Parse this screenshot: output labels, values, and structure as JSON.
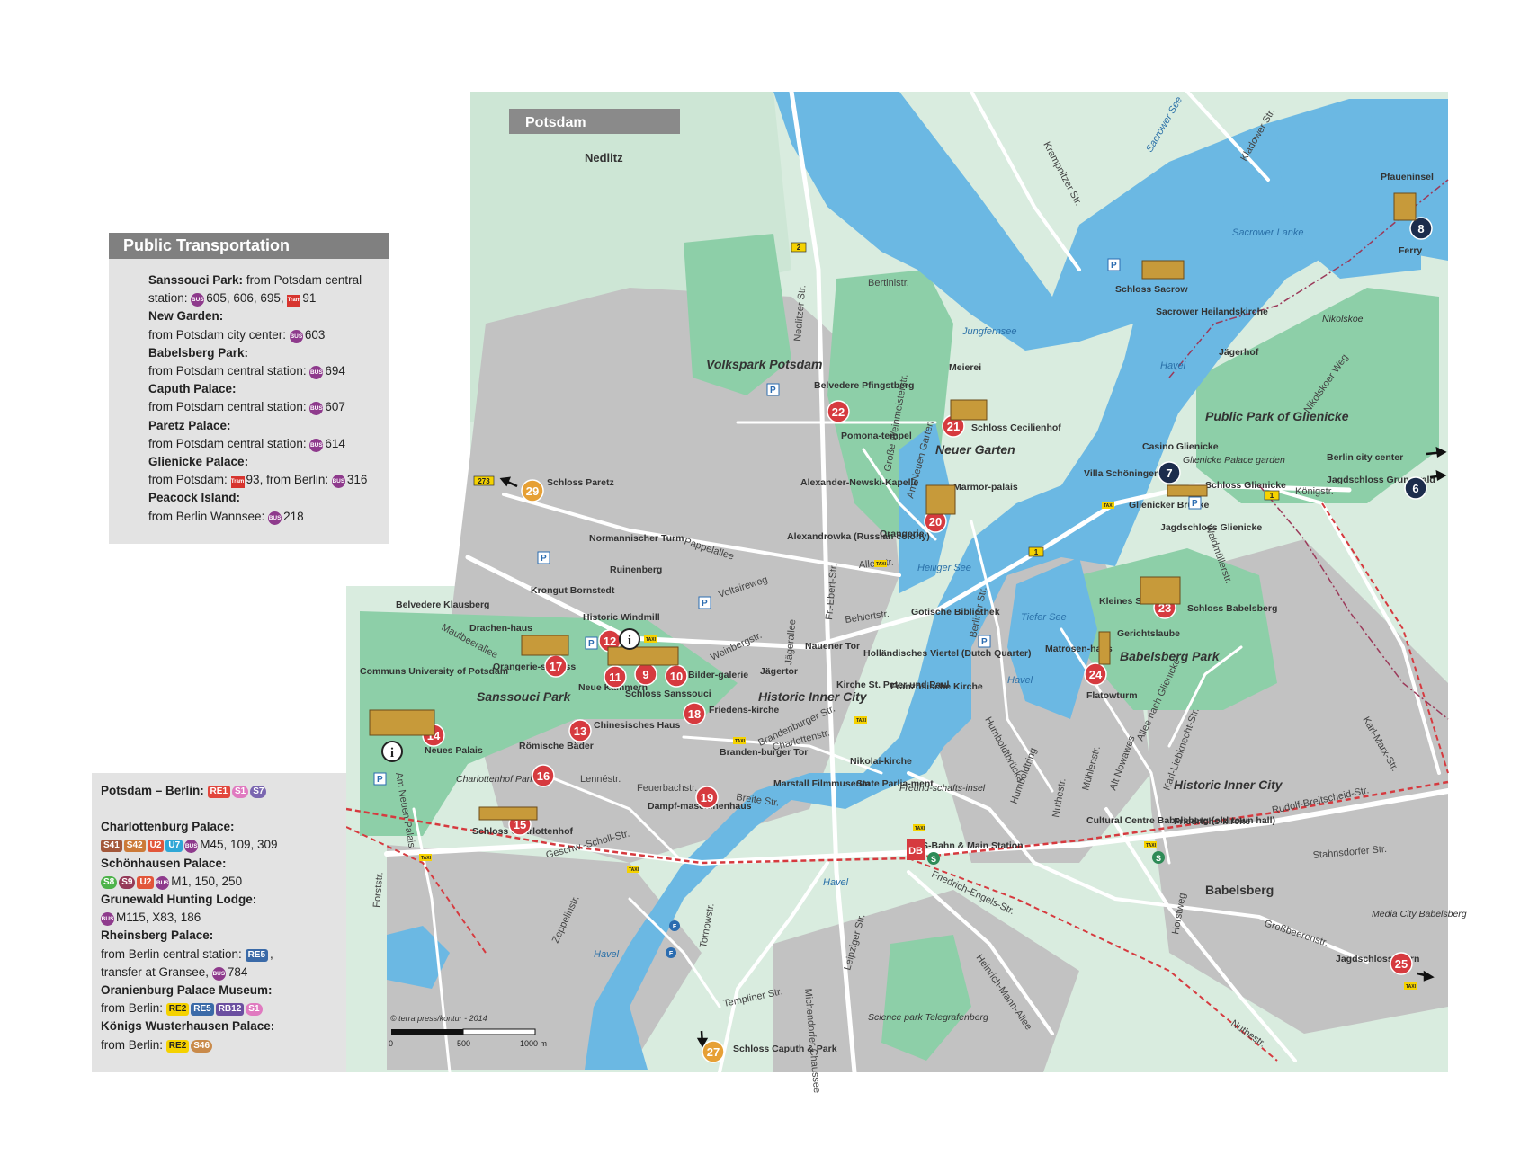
{
  "map": {
    "title": "Potsdam",
    "districts": [
      "Nedlitz",
      "Volkspark Potsdam",
      "Sanssouci Park",
      "Neuer Garten",
      "Historic Inner City",
      "Babelsberg Park",
      "Babelsberg",
      "Public Park of Glienicke",
      "Historic Inner City"
    ],
    "water_labels": [
      "Jungfernsee",
      "Sacrower See",
      "Sacrower Lanke",
      "Heiliger See",
      "Tiefer See",
      "Havel",
      "Havel",
      "Havel",
      "Havel"
    ],
    "streets": [
      "Krampnitzer Str.",
      "Kladower Str.",
      "Nedlitzer Str.",
      "Bertinistr.",
      "Große Weinmeisterstr.",
      "Am Neuen Garten",
      "Pappelallee",
      "Voltaireweg",
      "Alleestr.",
      "Fr.-Ebert-Str.",
      "Jägerallee",
      "Behlertstr.",
      "Berliner Str.",
      "Maulbeerallee",
      "Weinbergstr.",
      "Brandenburger Str.",
      "Charlottenstr.",
      "Lennéstr.",
      "Feuerbachstr.",
      "Breite Str.",
      "Geschw.-Scholl-Str.",
      "Zeppelinstr.",
      "Tornowstr.",
      "Templiner Str.",
      "Michendorfer Chaussee",
      "Leipziger Str.",
      "Friedrich-Engels-Str.",
      "Heinrich-Mann-Allee",
      "Humboldtring",
      "Nuthestr.",
      "Mühlenstr.",
      "Alt Nowawes",
      "Allee nach Glienicke",
      "Karl-Liebknecht-Str.",
      "Rudolf-Breitscheid-Str.",
      "Karl-Marx-Str.",
      "Stahnsdorfer Str.",
      "Großbeerenstr.",
      "Horstweg",
      "Nuthestr.",
      "Forststr.",
      "Am Neuen Palais",
      "Königstr.",
      "Waldmüllerstr.",
      "Nikolskoer Weg",
      "Humboldtbrücke"
    ],
    "places": [
      "Schloss Sacrow",
      "Sacrower Heilandskirche",
      "Jägerhof",
      "Nikolskoe",
      "Pfaueninsel",
      "Ferry",
      "Meierei",
      "Belvedere Pfingstberg",
      "Pomona-tempel",
      "Alexander-Newski-Kapelle",
      "Alexandrowka (Russian colony)",
      "Marmor-palais",
      "Orangerie",
      "Villa Schöningen",
      "Glienicker Brücke",
      "Casino Glienicke",
      "Glienicke Palace garden",
      "Schloss Glienicke",
      "Jagdschloss Glienicke",
      "Berlin city center",
      "Jagdschloss Grunewald",
      "Normannischer Turm",
      "Ruinenberg",
      "Krongut Bornstedt",
      "Belvedere Klausberg",
      "Drachen-haus",
      "Historic Windmill",
      "Orangerie-schloss",
      "Neue Kammern",
      "Schloss Sanssouci",
      "Bilder-galerie",
      "Communs University of Potsdam",
      "Neues Palais",
      "Chinesisches Haus",
      "Friedens-kirche",
      "Römische Bäder",
      "Charlottenhof Park",
      "Schloss Charlottenhof",
      "Gotische Bibliothek",
      "Nauener Tor",
      "Jägertor",
      "Holländisches Viertel (Dutch Quarter)",
      "Kirche St. Peter und Paul",
      "Französische Kirche",
      "Branden-burger Tor",
      "Nikolai-kirche",
      "State Parlia-ment",
      "Marstall Filmmuseum",
      "Dampf-maschinenhaus",
      "Freund-schafts-insel",
      "S-Bahn & Main Station",
      "Kleines Schloss",
      "Gerichtslaube",
      "Schloss Babelsberg",
      "Matrosen-haus",
      "Flatowturm",
      "Cultural Centre Babelsberg (old town hall)",
      "Friedrichs-kirche",
      "Media City Babelsberg",
      "Jagdschloss Stern",
      "Schloss Caputh & Park",
      "Science park Telegrafenberg",
      "Schloss Paretz",
      "Schloss Cecilienhof"
    ],
    "pois": [
      {
        "num": "6",
        "label": "Jagdschloss Grunewald",
        "color": "#1c2c4c"
      },
      {
        "num": "7",
        "label": "Casino Glienicke",
        "color": "#1c2c4c"
      },
      {
        "num": "8",
        "label": "Pfaueninsel",
        "color": "#1c2c4c"
      },
      {
        "num": "9",
        "label": "Schloss Sanssouci",
        "color": "#d63a3f"
      },
      {
        "num": "10",
        "label": "Bilder-galerie",
        "color": "#d63a3f"
      },
      {
        "num": "11",
        "label": "Neue Kammern",
        "color": "#d63a3f"
      },
      {
        "num": "12",
        "label": "Historic Windmill",
        "color": "#d63a3f"
      },
      {
        "num": "13",
        "label": "Chinesisches Haus",
        "color": "#d63a3f"
      },
      {
        "num": "14",
        "label": "Neues Palais",
        "color": "#d63a3f"
      },
      {
        "num": "15",
        "label": "Schloss Charlottenhof",
        "color": "#d63a3f"
      },
      {
        "num": "16",
        "label": "Römische Bäder",
        "color": "#d63a3f"
      },
      {
        "num": "17",
        "label": "Orangerie-schloss",
        "color": "#d63a3f"
      },
      {
        "num": "18",
        "label": "Friedens-kirche",
        "color": "#d63a3f"
      },
      {
        "num": "19",
        "label": "Dampf-maschinenhaus",
        "color": "#d63a3f"
      },
      {
        "num": "20",
        "label": "Marmor-palais",
        "color": "#d63a3f"
      },
      {
        "num": "21",
        "label": "Schloss Cecilienhof",
        "color": "#d63a3f"
      },
      {
        "num": "22",
        "label": "Belvedere Pfingstberg",
        "color": "#d63a3f"
      },
      {
        "num": "23",
        "label": "Schloss Babelsberg",
        "color": "#d63a3f"
      },
      {
        "num": "24",
        "label": "Flatowturm",
        "color": "#d63a3f"
      },
      {
        "num": "25",
        "label": "Jagdschloss Stern",
        "color": "#d63a3f"
      },
      {
        "num": "27",
        "label": "Schloss Caputh & Park",
        "color": "#e6a035"
      },
      {
        "num": "29",
        "label": "Schloss Paretz",
        "color": "#e6a035"
      }
    ],
    "road_numbers": [
      "2",
      "1",
      "1",
      "273"
    ],
    "copyright": "© terra press/kontur - 2014",
    "scale": [
      "0",
      "500",
      "1000 m"
    ],
    "colors": {
      "water": "#6bb8e3",
      "park": "#8dcfa8",
      "urban": "#b8b8b8",
      "land": "#d9ecdf",
      "road": "#ffffff",
      "rail": "#d63a3f"
    }
  },
  "transport": {
    "title": "Public Transportation",
    "entries": [
      {
        "title": "Sanssouci Park:",
        "line1": "from Potsdam central",
        "line2_pre": "station:",
        "line2_bus": "605, 606, 695,",
        "line2_tram": "91"
      },
      {
        "title": "New Garden:",
        "pre": "from Potsdam city center:",
        "bus": "603"
      },
      {
        "title": "Babelsberg Park:",
        "pre": "from Potsdam central station:",
        "bus": "694"
      },
      {
        "title": "Caputh Palace:",
        "pre": "from Potsdam central station:",
        "bus": "607"
      },
      {
        "title": "Paretz Palace:",
        "pre": "from Potsdam central station:",
        "bus": "614"
      },
      {
        "title": "Glienicke Palace:",
        "pre": "from Potsdam:",
        "tram": "93, from Berlin:",
        "bus": "316"
      },
      {
        "title": "Peacock Island:",
        "pre": "from Berlin Wannsee:",
        "bus": "218"
      }
    ],
    "bus_icon": "BUS",
    "tram_icon": "Tram"
  },
  "berlin": {
    "route_title": "Potsdam – Berlin:",
    "route_badges": [
      "RE1",
      "S1",
      "S7"
    ],
    "charlottenburg_title": "Charlottenburg Palace:",
    "charlottenburg_badges": [
      "S41",
      "S42",
      "U2",
      "U7"
    ],
    "charlottenburg_bus": "M45, 109, 309",
    "schoenhausen_title": "Schönhausen Palace:",
    "schoenhausen_badges": [
      "S8",
      "S9",
      "U2"
    ],
    "schoenhausen_bus": "M1, 150, 250",
    "grunewald_title": "Grunewald Hunting Lodge:",
    "grunewald_bus": "M115, X83, 186",
    "rheinsberg_title": "Rheinsberg Palace:",
    "rheinsberg_line1": "from Berlin central station:",
    "rheinsberg_badge": "RE5",
    "rheinsberg_line2": "transfer at Gransee,",
    "rheinsberg_bus": "784",
    "oranienburg_title": "Oranienburg Palace Museum:",
    "oranienburg_pre": "from Berlin:",
    "oranienburg_badges": [
      "RE2",
      "RE5",
      "RB12",
      "S1"
    ],
    "koenigs_title": "Königs Wusterhausen Palace:",
    "koenigs_pre": "from Berlin:",
    "koenigs_badges": [
      "RE2",
      "S46"
    ]
  }
}
